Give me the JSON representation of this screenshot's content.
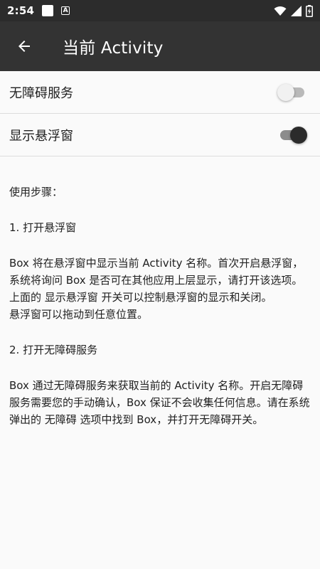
{
  "status_bar": {
    "time": "2:54",
    "notif_a": "A",
    "icons": [
      "notification-square-icon",
      "notification-a-icon",
      "wifi-icon",
      "signal-icon",
      "battery-charging-icon"
    ]
  },
  "toolbar": {
    "back_icon": "arrow-back-icon",
    "title": "当前 Activity"
  },
  "settings": {
    "accessibility": {
      "label": "无障碍服务",
      "enabled": false
    },
    "floating_window": {
      "label": "显示悬浮窗",
      "enabled": true
    }
  },
  "instructions": {
    "heading": "使用步骤：",
    "step1_title": "1. 打开悬浮窗",
    "step1_text1": " Box 将在悬浮窗中显示当前 Activity 名称。首次开启悬浮窗，系统将询问 Box 是否可在其他应用上层显示，请打开该选项。",
    "step1_text2": "上面的 显示悬浮窗 开关可以控制悬浮窗的显示和关闭。",
    "step1_text3": "悬浮窗可以拖动到任意位置。",
    "step2_title": "2. 打开无障碍服务",
    "step2_text": " Box 通过无障碍服务来获取当前的 Activity 名称。开启无障碍服务需要您的手动确认，Box 保证不会收集任何信息。请在系统弹出的 无障碍 选项中找到 Box，并打开无障碍开关。"
  },
  "colors": {
    "status_bar": "#2c2c2c",
    "toolbar": "#333333",
    "background": "#fafafa",
    "switch_on_thumb": "#2b2b2b"
  }
}
